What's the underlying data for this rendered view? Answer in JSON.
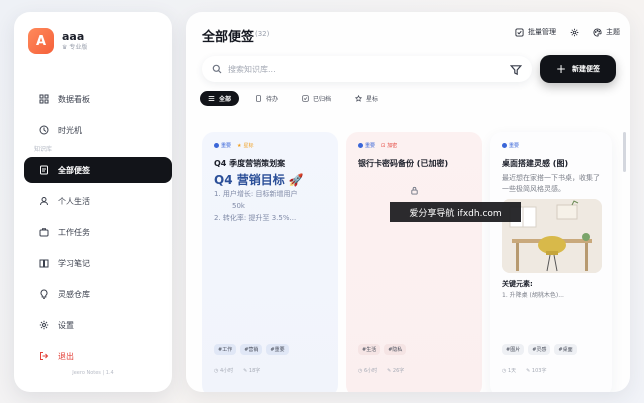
{
  "user": {
    "initial": "A",
    "name": "aaa",
    "plan": "专业版"
  },
  "sidebar": {
    "items": [
      {
        "label": "数据看板",
        "icon": "grid-icon"
      },
      {
        "label": "时光机",
        "icon": "history-icon"
      }
    ],
    "section": "知识库",
    "items2": [
      {
        "label": "全部便签",
        "icon": "note-icon",
        "active": true
      },
      {
        "label": "个人生活",
        "icon": "user-icon"
      },
      {
        "label": "工作任务",
        "icon": "briefcase-icon"
      },
      {
        "label": "学习笔记",
        "icon": "book-icon"
      },
      {
        "label": "灵感仓库",
        "icon": "bulb-icon"
      }
    ],
    "settings": "设置",
    "logout": "退出",
    "version": "Jeero Notes | 1.4"
  },
  "header": {
    "title": "全部便签",
    "count": "(32)",
    "batch": "批量管理",
    "theme": "主题"
  },
  "search": {
    "placeholder": "搜索知识库..."
  },
  "new_button": "新建便签",
  "tabs": [
    {
      "label": "全部",
      "active": true
    },
    {
      "label": "待办"
    },
    {
      "label": "已归档"
    },
    {
      "label": "星标"
    }
  ],
  "cards": [
    {
      "badges": [
        "重要",
        "星标"
      ],
      "title": "Q4 季度营销策划案",
      "heading": "Q4 营销目标 🚀",
      "lines": [
        "1. 用户增长: 目标新增用户",
        "50k",
        "2. 转化率: 提升至 3.5%..."
      ],
      "tags": [
        "#工作",
        "#营销",
        "#重要"
      ],
      "stats": [
        "4小时",
        "18字"
      ]
    },
    {
      "badges": [
        "重要",
        "加密"
      ],
      "title": "银行卡密码备份 (已加密)",
      "tags": [
        "#生活",
        "#隐私"
      ],
      "stats": [
        "6小时",
        "26字"
      ]
    },
    {
      "badges": [
        "重要"
      ],
      "title": "桌面搭建灵感 (图)",
      "desc": "最近想在家搭一下书桌，收集了一些极简风格灵感。",
      "sub": "关键元素:",
      "sub_line": "1. 升降桌 (胡桃木色)...",
      "tags": [
        "#图片",
        "#灵感",
        "#桌面"
      ],
      "stats": [
        "1天",
        "103字"
      ]
    }
  ],
  "watermark": "爱分享导航 ifxdh.com",
  "colors": {
    "accent": "#121419",
    "logout": "#e3433b",
    "badge_blue": "#3a66d8",
    "badge_orange": "#f0a021",
    "badge_red": "#e3433b"
  }
}
